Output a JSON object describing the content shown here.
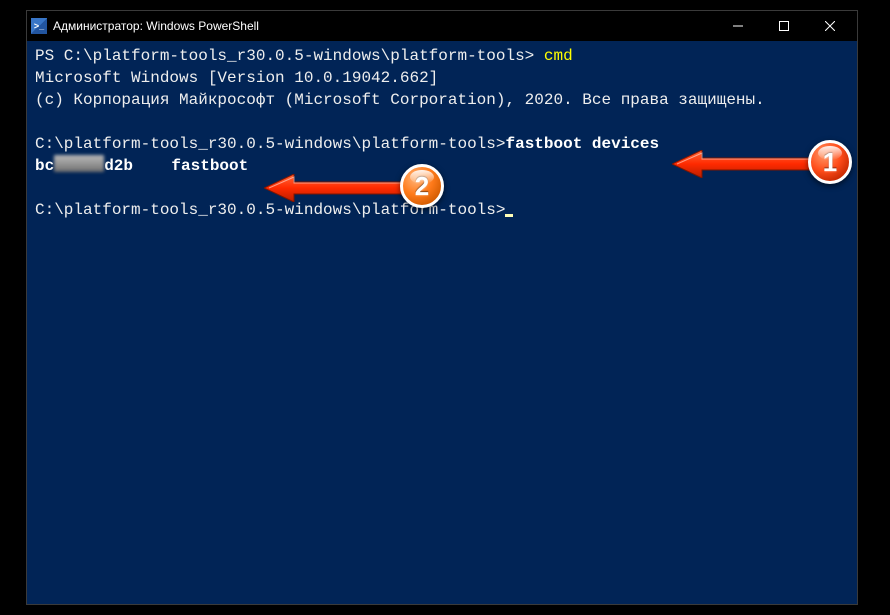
{
  "titlebar": {
    "icon_label": ">_",
    "title": "Администратор: Windows PowerShell"
  },
  "terminal": {
    "ps_prompt": "PS C:\\platform-tools_r30.0.5-windows\\platform-tools> ",
    "cmd_input": "cmd",
    "ms_line": "Microsoft Windows [Version 10.0.19042.662]",
    "copyright": "(c) Корпорация Майкрософт (Microsoft Corporation), 2020. Все права защищены.",
    "cmd_prompt": "C:\\platform-tools_r30.0.5-windows\\platform-tools>",
    "fastboot_cmd": "fastboot devices",
    "device_prefix": "bc",
    "device_suffix": "d2b",
    "device_mode": "    fastboot"
  },
  "annotations": {
    "badge1": "1",
    "badge2": "2"
  }
}
